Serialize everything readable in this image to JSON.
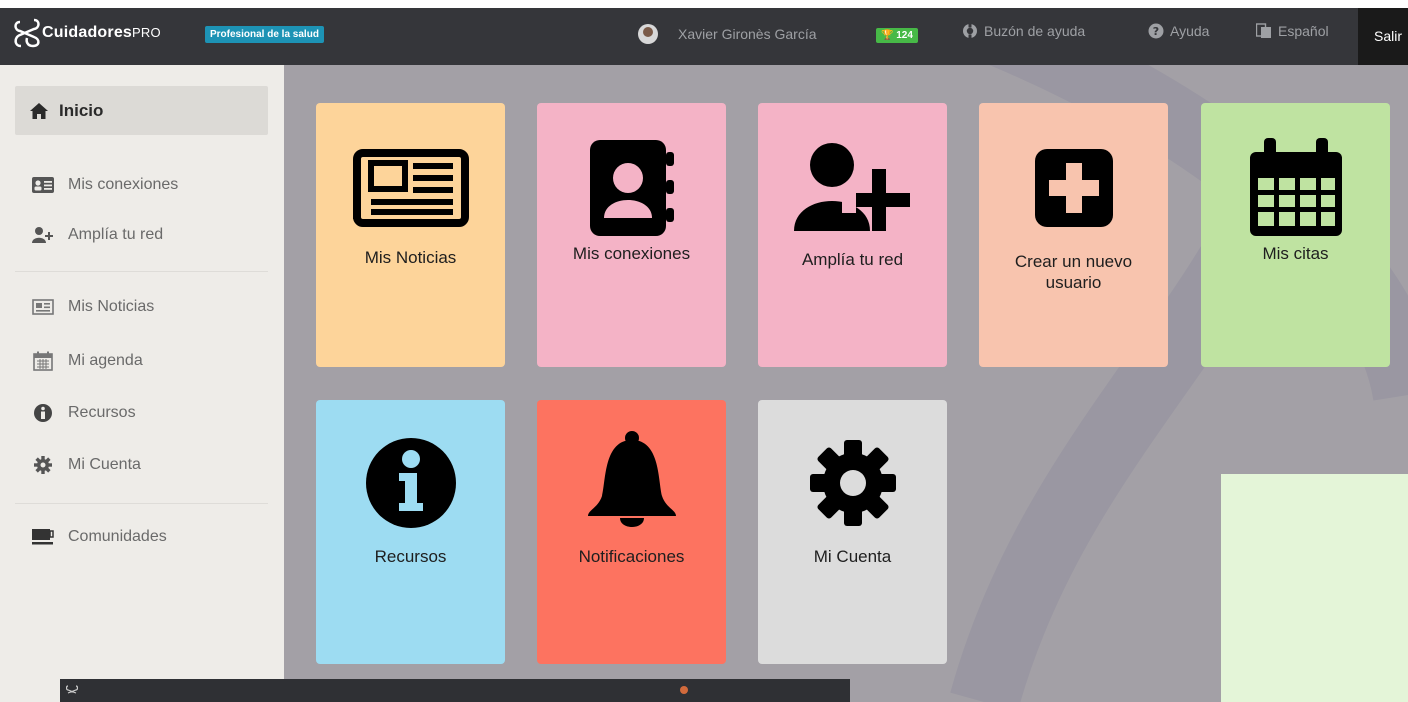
{
  "brand": {
    "name": "Cuidadores",
    "name_suffix": "PRO",
    "role_badge": "Profesional de la salud"
  },
  "header": {
    "user_name": "Xavier Gironès García",
    "points": "124",
    "help_mailbox": "Buzón de ayuda",
    "help": "Ayuda",
    "language": "Español",
    "logout": "Salir"
  },
  "sidebar": {
    "active": "Inicio",
    "items": [
      {
        "label": "Mis conexiones",
        "icon": "id-card-icon"
      },
      {
        "label": "Amplía tu red",
        "icon": "add-user-icon"
      },
      {
        "label": "Mis Noticias",
        "icon": "newspaper-icon"
      },
      {
        "label": "Mi agenda",
        "icon": "calendar-icon"
      },
      {
        "label": "Recursos",
        "icon": "info-icon"
      },
      {
        "label": "Mi Cuenta",
        "icon": "gear-icon"
      },
      {
        "label": "Comunidades",
        "icon": "coffee-icon"
      }
    ]
  },
  "tiles": [
    {
      "label": "Mis Noticias",
      "color": "#fdd49a",
      "icon": "newspaper-icon"
    },
    {
      "label": "Mis conexiones",
      "color": "#f4b3c6",
      "icon": "address-book-icon"
    },
    {
      "label": "Amplía tu red",
      "color": "#f4b3c6",
      "icon": "add-user-icon"
    },
    {
      "label": "Crear un nuevo usuario",
      "color": "#f8c4ae",
      "icon": "plus-square-icon"
    },
    {
      "label": "Mis citas",
      "color": "#bfe3a1",
      "icon": "calendar-icon"
    },
    {
      "label": "Recursos",
      "color": "#9ddcf2",
      "icon": "info-icon"
    },
    {
      "label": "Notificaciones",
      "color": "#fd7360",
      "icon": "bell-icon"
    },
    {
      "label": "Mi Cuenta",
      "color": "#dcdcdc",
      "icon": "gear-icon"
    }
  ]
}
